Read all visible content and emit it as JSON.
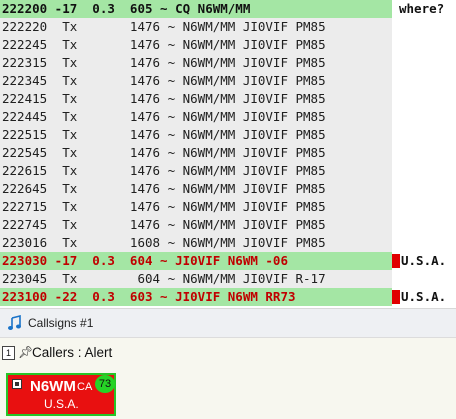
{
  "log": {
    "rows": [
      {
        "text": "222200 -17  0.3  605 ~ CQ N6WM/MM",
        "side": "where?",
        "style": "cq",
        "marker": false
      },
      {
        "text": "222220  Tx       1476 ~ N6WM/MM JI0VIF PM85",
        "side": "",
        "style": "tx",
        "marker": false
      },
      {
        "text": "222245  Tx       1476 ~ N6WM/MM JI0VIF PM85",
        "side": "",
        "style": "tx",
        "marker": false
      },
      {
        "text": "222315  Tx       1476 ~ N6WM/MM JI0VIF PM85",
        "side": "",
        "style": "tx",
        "marker": false
      },
      {
        "text": "222345  Tx       1476 ~ N6WM/MM JI0VIF PM85",
        "side": "",
        "style": "tx",
        "marker": false
      },
      {
        "text": "222415  Tx       1476 ~ N6WM/MM JI0VIF PM85",
        "side": "",
        "style": "tx",
        "marker": false
      },
      {
        "text": "222445  Tx       1476 ~ N6WM/MM JI0VIF PM85",
        "side": "",
        "style": "tx",
        "marker": false
      },
      {
        "text": "222515  Tx       1476 ~ N6WM/MM JI0VIF PM85",
        "side": "",
        "style": "tx",
        "marker": false
      },
      {
        "text": "222545  Tx       1476 ~ N6WM/MM JI0VIF PM85",
        "side": "",
        "style": "tx",
        "marker": false
      },
      {
        "text": "222615  Tx       1476 ~ N6WM/MM JI0VIF PM85",
        "side": "",
        "style": "tx",
        "marker": false
      },
      {
        "text": "222645  Tx       1476 ~ N6WM/MM JI0VIF PM85",
        "side": "",
        "style": "tx",
        "marker": false
      },
      {
        "text": "222715  Tx       1476 ~ N6WM/MM JI0VIF PM85",
        "side": "",
        "style": "tx",
        "marker": false
      },
      {
        "text": "222745  Tx       1476 ~ N6WM/MM JI0VIF PM85",
        "side": "",
        "style": "tx",
        "marker": false
      },
      {
        "text": "223016  Tx       1608 ~ N6WM/MM JI0VIF PM85",
        "side": "",
        "style": "tx",
        "marker": false
      },
      {
        "text": "223030 -17  0.3  604 ~ JI0VIF N6WM -06",
        "side": "U.S.A.",
        "style": "hl",
        "marker": true
      },
      {
        "text": "223045  Tx        604 ~ N6WM/MM JI0VIF R-17",
        "side": "",
        "style": "tx",
        "marker": false
      },
      {
        "text": "223100 -22  0.3  603 ~ JI0VIF N6WM RR73",
        "side": "U.S.A.",
        "style": "hl",
        "marker": true
      }
    ]
  },
  "window": {
    "title": "Callsigns #1"
  },
  "panel": {
    "index": "1",
    "label": "Callers : Alert"
  },
  "card": {
    "callsign": "N6WM",
    "state": "CA",
    "count": "73",
    "country": "U.S.A."
  },
  "colors": {
    "decode_highlight": "#a4e6a4",
    "tx_row": "#ececec",
    "alert_card": "#e81010",
    "card_border": "#27c527",
    "count_badge": "#26d426"
  }
}
